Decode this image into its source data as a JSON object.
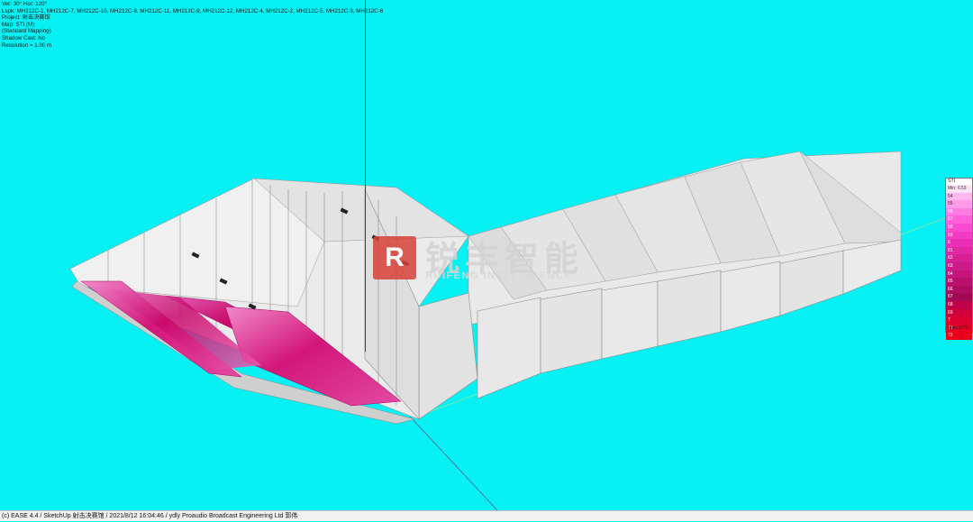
{
  "info": {
    "view": "Ver: 30°   Hor: 120°",
    "lspk": "Lspk: MH212C-1, MH212C-7, MH212C-10, MH212C-8, MH212C-11, MH212C-9, MH212C-12, MH212C-4, MH212C-2, MH212C-5, MH212C-3, MH212C-6",
    "project": "Project: 射击决赛馆",
    "map": "Map: STI (M)",
    "mapping": "(Standard Mapping)",
    "shadow": "Shadow Cast: No",
    "resolution": "Resolution = 1.00 m"
  },
  "watermark": {
    "logo": "R",
    "cn": "锐丰智能",
    "en": "RUIFENG INTELLIGENCE"
  },
  "legend": {
    "title": "STI",
    "rows": [
      {
        "label": "Min: 0.53",
        "color": "#ffe3f6"
      },
      {
        "label": "54",
        "color": "#ffb8ee"
      },
      {
        "label": "55",
        "color": "#ff9be9"
      },
      {
        "label": "56",
        "color": "#ff7de3"
      },
      {
        "label": "57",
        "color": "#ff60dc"
      },
      {
        "label": "58",
        "color": "#f94ad2"
      },
      {
        "label": "59",
        "color": "#f23ac4"
      },
      {
        "label": "6",
        "color": "#ea2fb6"
      },
      {
        "label": "61",
        "color": "#e027a6"
      },
      {
        "label": "62",
        "color": "#d72097"
      },
      {
        "label": "63",
        "color": "#cd1a89"
      },
      {
        "label": "64",
        "color": "#c3157b"
      },
      {
        "label": "65",
        "color": "#b9106d"
      },
      {
        "label": "66",
        "color": "#ae0c60"
      },
      {
        "label": "67",
        "color": "#a30853"
      },
      {
        "label": "68",
        "color": "#c00048"
      },
      {
        "label": "69",
        "color": "#d1003c"
      },
      {
        "label": "7",
        "color": "#dc0030"
      },
      {
        "label": "71",
        "color": "#e40024"
      },
      {
        "label": "72",
        "color": "#ea0018"
      }
    ],
    "max": "Max: 0.73"
  },
  "status": "(c) EASE 4.4  / SketchUp 射击决赛馆  / 2021/8/12 16:04:46 / ydly Proaudio Broadcast Engineering Ltd  郭伟",
  "colors": {
    "background": "#07f0f4",
    "wall": "#e8e8e8",
    "wall_shadow": "#d2d2d2",
    "sti_hot": "#d8127a"
  }
}
